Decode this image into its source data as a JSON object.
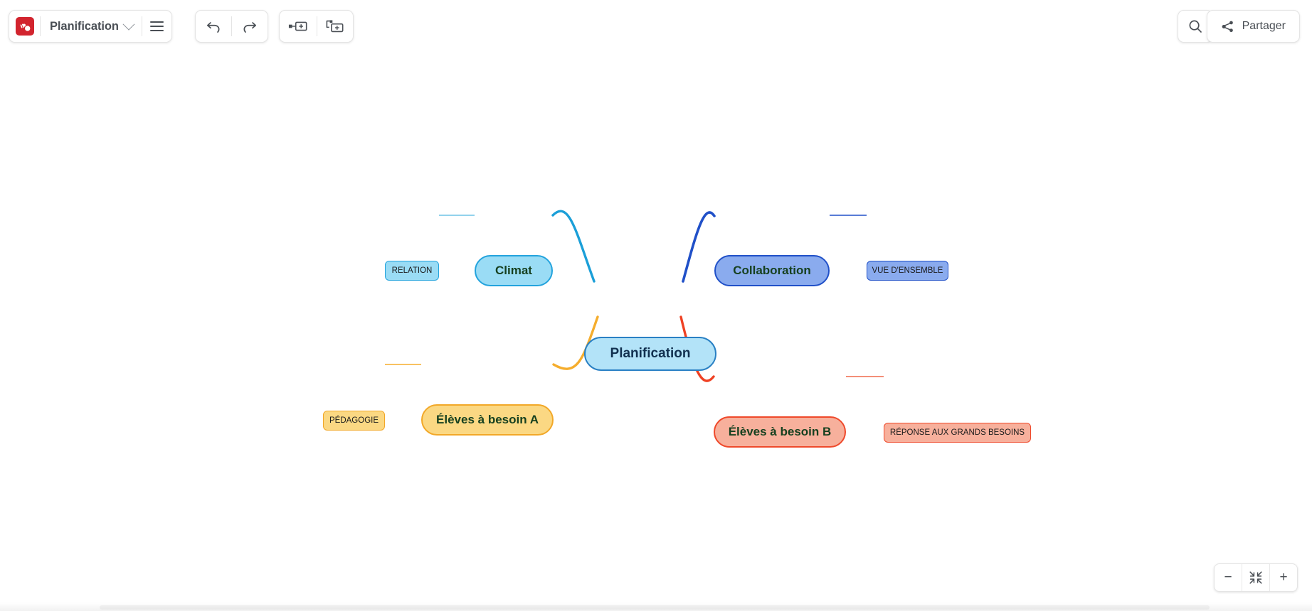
{
  "app": {
    "logo_icon": "mindmeister-logo-icon",
    "document_title": "Planification",
    "title_dropdown_icon": "chevron-down-icon",
    "menu_icon": "hamburger-menu-icon"
  },
  "toolbar": {
    "undo_icon": "undo-arrow-icon",
    "redo_icon": "redo-arrow-icon",
    "add_sibling_icon": "add-sibling-node-icon",
    "add_child_icon": "add-child-node-icon",
    "search_icon": "search-icon",
    "share_icon": "share-network-icon",
    "share_label": "Partager"
  },
  "zoom_controls": {
    "zoom_out_label": "−",
    "fit_icon": "fit-to-screen-icon",
    "zoom_in_label": "+"
  },
  "mindmap": {
    "root": {
      "label": "Planification",
      "fill": "#b3e3f8",
      "stroke": "#2980c4",
      "text_color": "#11304f"
    },
    "branches": [
      {
        "id": "climat",
        "label": "Climat",
        "fill": "#9adcf5",
        "stroke": "#23a3dd",
        "connector_color": "#1b9fd8",
        "children": [
          {
            "id": "relation",
            "label": "RELATION",
            "fill": "#9adcf5",
            "stroke": "#23a3dd"
          }
        ]
      },
      {
        "id": "collaboration",
        "label": "Collaboration",
        "fill": "#8aabee",
        "stroke": "#2050c8",
        "connector_color": "#2050c8",
        "children": [
          {
            "id": "vue-densemble",
            "label": "VUE D'ENSEMBLE",
            "fill": "#8aabee",
            "stroke": "#2050c8"
          }
        ]
      },
      {
        "id": "eleves-besoin-a",
        "label": "Élèves à besoin A",
        "fill": "#fbd883",
        "stroke": "#f2a828",
        "connector_color": "#f5ad2d",
        "children": [
          {
            "id": "pedagogie",
            "label": "PÉDAGOGIE",
            "fill": "#fbd883",
            "stroke": "#f2a828"
          }
        ]
      },
      {
        "id": "eleves-besoin-b",
        "label": "Élèves à besoin B",
        "fill": "#f7b09c",
        "stroke": "#ef492b",
        "connector_color": "#ef4123",
        "children": [
          {
            "id": "reponse-grands-besoins",
            "label": "RÉPONSE AUX GRANDS BESOINS",
            "fill": "#f7b09c",
            "stroke": "#ef492b"
          }
        ]
      }
    ]
  }
}
